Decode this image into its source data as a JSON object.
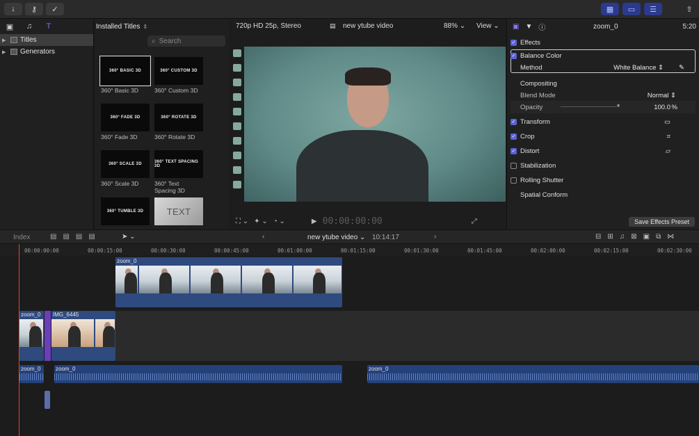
{
  "toolbar": {
    "import_icon": "down-arrow-icon",
    "keyword_icon": "key-icon",
    "check_icon": "checkmark-icon"
  },
  "sidebar": {
    "items": [
      {
        "label": "Titles"
      },
      {
        "label": "Generators"
      }
    ]
  },
  "browser": {
    "title": "Installed Titles",
    "search_placeholder": "Search",
    "tiles": [
      {
        "thumb": "360° BASIC 3D",
        "label": "360° Basic 3D"
      },
      {
        "thumb": "360° CUSTOM 3D",
        "label": "360° Custom 3D"
      },
      {
        "thumb": "360° FADE 3D",
        "label": "360° Fade 3D"
      },
      {
        "thumb": "360° ROTATE 3D",
        "label": "360° Rotate 3D"
      },
      {
        "thumb": "360° SCALE 3D",
        "label": "360° Scale 3D"
      },
      {
        "thumb": "360° TEXT SPACING 3D",
        "label": "360° Text Spacing 3D"
      },
      {
        "thumb": "360° TUMBLE 3D",
        "label": ""
      },
      {
        "thumb": "TEXT",
        "label": ""
      }
    ]
  },
  "viewer": {
    "format": "720p HD 25p, Stereo",
    "project": "new ytube video",
    "zoom": "88%",
    "view_label": "View",
    "timecode": "00:00:00:00"
  },
  "inspector": {
    "clip_name": "zoom_0",
    "duration": "5:20",
    "effects_label": "Effects",
    "balance_color_label": "Balance Color",
    "method_label": "Method",
    "method_value": "White Balance",
    "compositing_label": "Compositing",
    "blend_mode_label": "Blend Mode",
    "blend_mode_value": "Normal",
    "opacity_label": "Opacity",
    "opacity_value": "100.0",
    "opacity_unit": "%",
    "transform_label": "Transform",
    "crop_label": "Crop",
    "distort_label": "Distort",
    "stabilization_label": "Stabilization",
    "rolling_shutter_label": "Rolling Shutter",
    "spatial_conform_label": "Spatial Conform",
    "save_preset_label": "Save Effects Preset"
  },
  "timeline": {
    "index_label": "Index",
    "project": "new ytube video",
    "duration": "10:14:17",
    "ruler": [
      "00:00:00:00",
      "00:00:15:00",
      "00:00:30:00",
      "00:00:45:00",
      "00:01:00:00",
      "00:01:15:00",
      "00:01:30:00",
      "00:01:45:00",
      "00:02:00:00",
      "00:02:15:00",
      "00:02:30:00"
    ],
    "connected_clip": "zoom_0",
    "primary_clip_1": "zoom_0",
    "primary_clip_2": "IMG_6445",
    "audio_clip_1": "zoom_0",
    "audio_clip_2": "zoom_0",
    "audio_clip_3": "zoom_0"
  },
  "colors": {
    "accent": "#5b62d9",
    "clip": "#2e4a7e",
    "playhead": "#d94a3a"
  }
}
